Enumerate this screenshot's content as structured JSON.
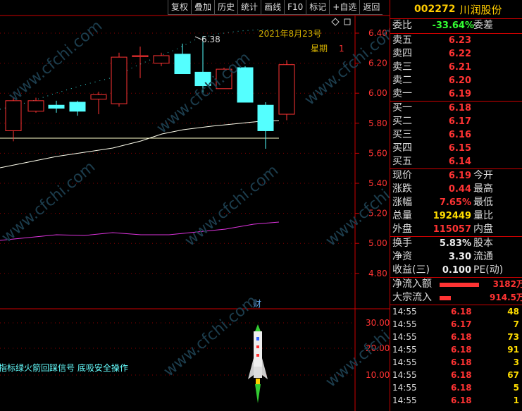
{
  "toolbar": [
    "复权",
    "叠加",
    "历史",
    "统计",
    "画线",
    "F10",
    "标记",
    "+自选",
    "返回"
  ],
  "stock": {
    "code": "002272",
    "name": "川润股份"
  },
  "main_chart": {
    "date_label": "2021年8月23号",
    "weekday_label": "星期",
    "weekday_value": "1",
    "high_label": "6.38",
    "price_axis": [
      "6.40",
      "6.20",
      "6.00",
      "5.80",
      "5.60",
      "5.40",
      "5.20",
      "5.00",
      "4.80"
    ],
    "marker": "财"
  },
  "sub_chart": {
    "axis": [
      "30.00",
      "20.00",
      "10.00"
    ],
    "signal_text": "指标绿火箭回踩信号 底吸安全操作"
  },
  "quote": {
    "weibi": {
      "label": "委比",
      "value": "-33.64%",
      "label2": "委差"
    },
    "sells": [
      {
        "label": "卖五",
        "price": "6.23"
      },
      {
        "label": "卖四",
        "price": "6.22"
      },
      {
        "label": "卖三",
        "price": "6.21"
      },
      {
        "label": "卖二",
        "price": "6.20"
      },
      {
        "label": "卖一",
        "price": "6.19"
      }
    ],
    "buys": [
      {
        "label": "买一",
        "price": "6.18"
      },
      {
        "label": "买二",
        "price": "6.17"
      },
      {
        "label": "买三",
        "price": "6.16"
      },
      {
        "label": "买四",
        "price": "6.15"
      },
      {
        "label": "买五",
        "price": "6.14"
      }
    ],
    "stats": [
      {
        "label": "现价",
        "value": "6.19",
        "label2": "今开",
        "color": "red"
      },
      {
        "label": "涨跌",
        "value": "0.44",
        "label2": "最高",
        "color": "red"
      },
      {
        "label": "涨幅",
        "value": "7.65%",
        "label2": "最低",
        "color": "red"
      },
      {
        "label": "总量",
        "value": "192449",
        "label2": "量比",
        "color": "yellow"
      },
      {
        "label": "外盘",
        "value": "115057",
        "label2": "内盘",
        "color": "red"
      }
    ],
    "stats2": [
      {
        "label": "换手",
        "value": "5.83%",
        "label2": "股本",
        "color": "white"
      },
      {
        "label": "净资",
        "value": "3.30",
        "label2": "流通",
        "color": "white"
      },
      {
        "label": "收益(三)",
        "value": "0.100",
        "label2": "PE(动)",
        "color": "white"
      }
    ],
    "flows": [
      {
        "label": "净流入额",
        "value": "3182万",
        "bar": 0.7
      },
      {
        "label": "大宗流入",
        "value": "914.5万",
        "bar": 0.2
      }
    ],
    "ticks": [
      {
        "time": "14:55",
        "price": "6.18",
        "vol": "48"
      },
      {
        "time": "14:55",
        "price": "6.17",
        "vol": "7"
      },
      {
        "time": "14:55",
        "price": "6.18",
        "vol": "73"
      },
      {
        "time": "14:55",
        "price": "6.18",
        "vol": "91"
      },
      {
        "time": "14:55",
        "price": "6.18",
        "vol": "3"
      },
      {
        "time": "14:55",
        "price": "6.18",
        "vol": "67"
      },
      {
        "time": "14:55",
        "price": "6.18",
        "vol": "5"
      },
      {
        "time": "14:55",
        "price": "6.18",
        "vol": "1"
      }
    ]
  },
  "watermark": "www.cfchi.com",
  "colors": {
    "up": "#ff3333",
    "down": "#54ffff",
    "ma_short": "#33cccc",
    "ma_long": "#ffffdd",
    "ma_purple": "#dd33dd",
    "border": "#cc0000"
  }
}
